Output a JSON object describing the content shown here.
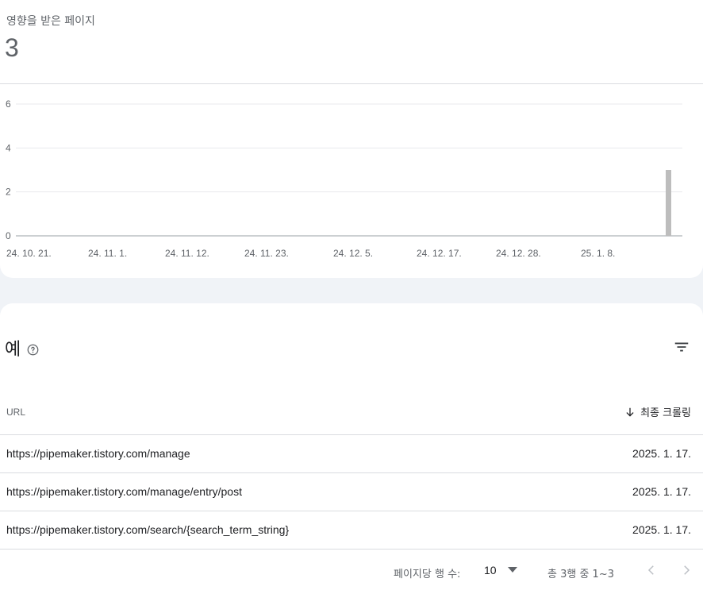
{
  "summary": {
    "label": "영향을 받은 페이지",
    "value": "3"
  },
  "chart_data": {
    "type": "bar",
    "y_ticks": [
      "0",
      "2",
      "4",
      "6"
    ],
    "ylim": [
      0,
      6
    ],
    "x_ticks": [
      "24. 10. 21.",
      "24. 11. 1.",
      "24. 11. 12.",
      "24. 11. 23.",
      "24. 12. 5.",
      "24. 12. 17.",
      "24. 12. 28.",
      "25. 1. 8."
    ],
    "values": [
      {
        "date": "25. 1. 17.",
        "value": 3
      }
    ],
    "grid": true,
    "bar_color": "#bdbdbd"
  },
  "examples": {
    "title": "예",
    "columns": {
      "url": "URL",
      "last_crawl": "최종 크롤링"
    },
    "rows": [
      {
        "url": "https://pipemaker.tistory.com/manage",
        "date": "2025. 1. 17."
      },
      {
        "url": "https://pipemaker.tistory.com/manage/entry/post",
        "date": "2025. 1. 17."
      },
      {
        "url": "https://pipemaker.tistory.com/search/{search_term_string}",
        "date": "2025. 1. 17."
      }
    ]
  },
  "pagination": {
    "rows_per_page_label": "페이지당 행 수:",
    "rows_per_page": "10",
    "range": "총 3행 중 1~3"
  }
}
